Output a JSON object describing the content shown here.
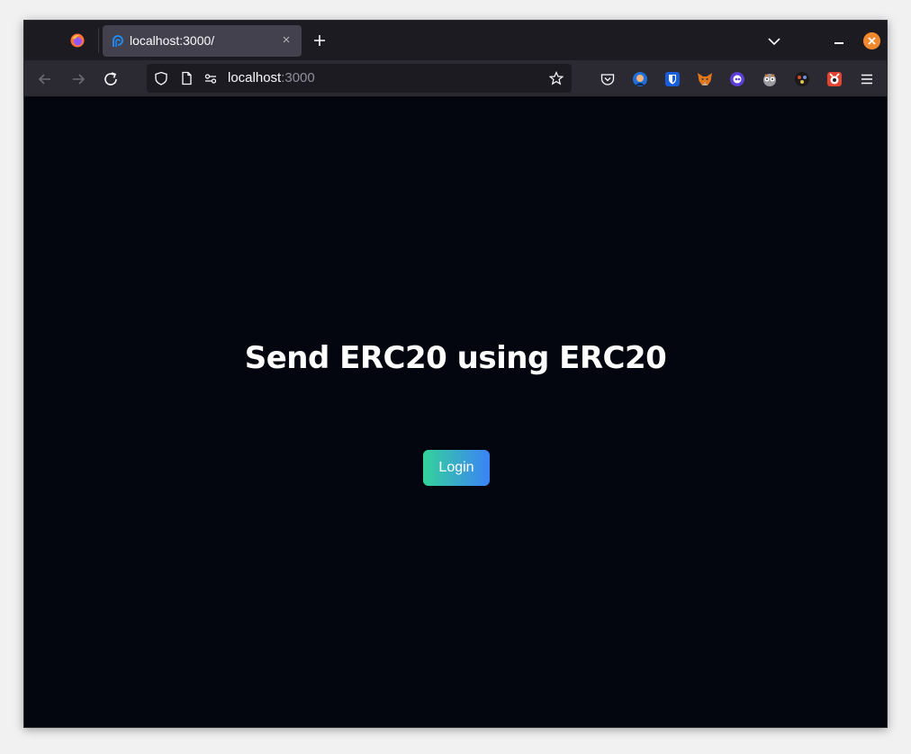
{
  "browser": {
    "tab": {
      "title": "localhost:3000/",
      "close_glyph": "×"
    },
    "url": {
      "host": "localhost",
      "port": ":3000"
    },
    "icons": [
      "firefox-icon",
      "tab-favicon",
      "new-tab-icon",
      "list-all-tabs-icon",
      "minimize-icon",
      "close-window-icon",
      "back-icon",
      "forward-icon",
      "reload-icon",
      "tracking-protection-shield-icon",
      "page-info-icon",
      "permissions-icon",
      "bookmark-star-icon",
      "pocket-icon",
      "extension-icon",
      "bitwarden-icon",
      "metamask-icon",
      "extension-icon",
      "extension-icon",
      "extension-icon",
      "extension-icon",
      "app-menu-icon"
    ]
  },
  "page": {
    "headline": "Send ERC20 using ERC20",
    "login_label": "Login"
  },
  "colors": {
    "page_bg": "#03060f",
    "button_gradient_start": "#34d399",
    "button_gradient_end": "#3b82f6",
    "close_button": "#f0892d"
  }
}
